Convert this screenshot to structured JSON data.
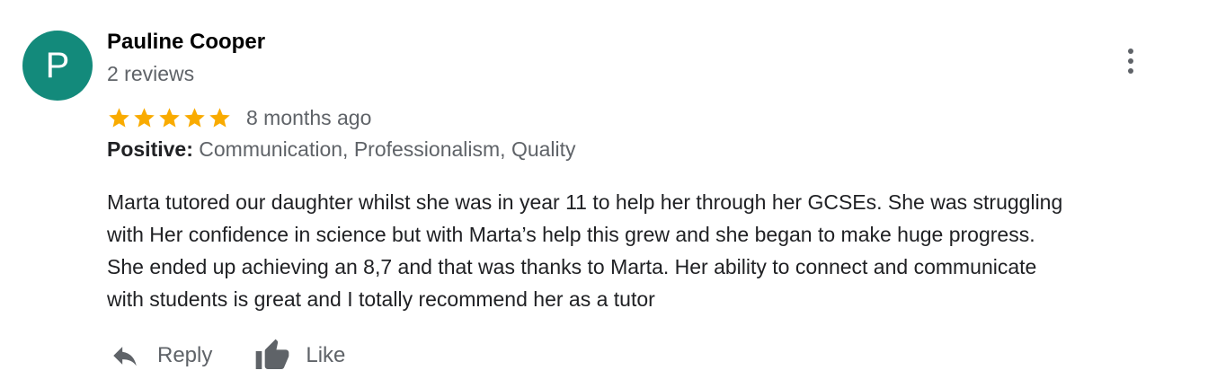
{
  "review": {
    "avatar_letter": "P",
    "avatar_color": "#138a7b",
    "reviewer_name": "Pauline Cooper",
    "reviewer_reviews": "2 reviews",
    "rating": 5,
    "rating_max": 5,
    "star_color": "#f9ab00",
    "time_ago": "8 months ago",
    "positive_label": "Positive:",
    "positive_values": "Communication, Professionalism, Quality",
    "body_lines": [
      "Marta tutored our daughter whilst she was in year 11 to help her through her GCSEs. She was struggling",
      "with Her confidence in science but with Marta’s help this grew and she began to make huge progress.",
      "She ended up achieving an 8,7 and that was thanks to Marta. Her ability to connect and communicate",
      "with students is great and I totally recommend her as a tutor"
    ],
    "more_icon": "more-vertical-icon"
  },
  "actions": {
    "reply_label": "Reply",
    "reply_icon": "reply-arrow-icon",
    "like_label": "Like",
    "like_icon": "thumbs-up-icon",
    "icon_color": "#5f6368"
  }
}
